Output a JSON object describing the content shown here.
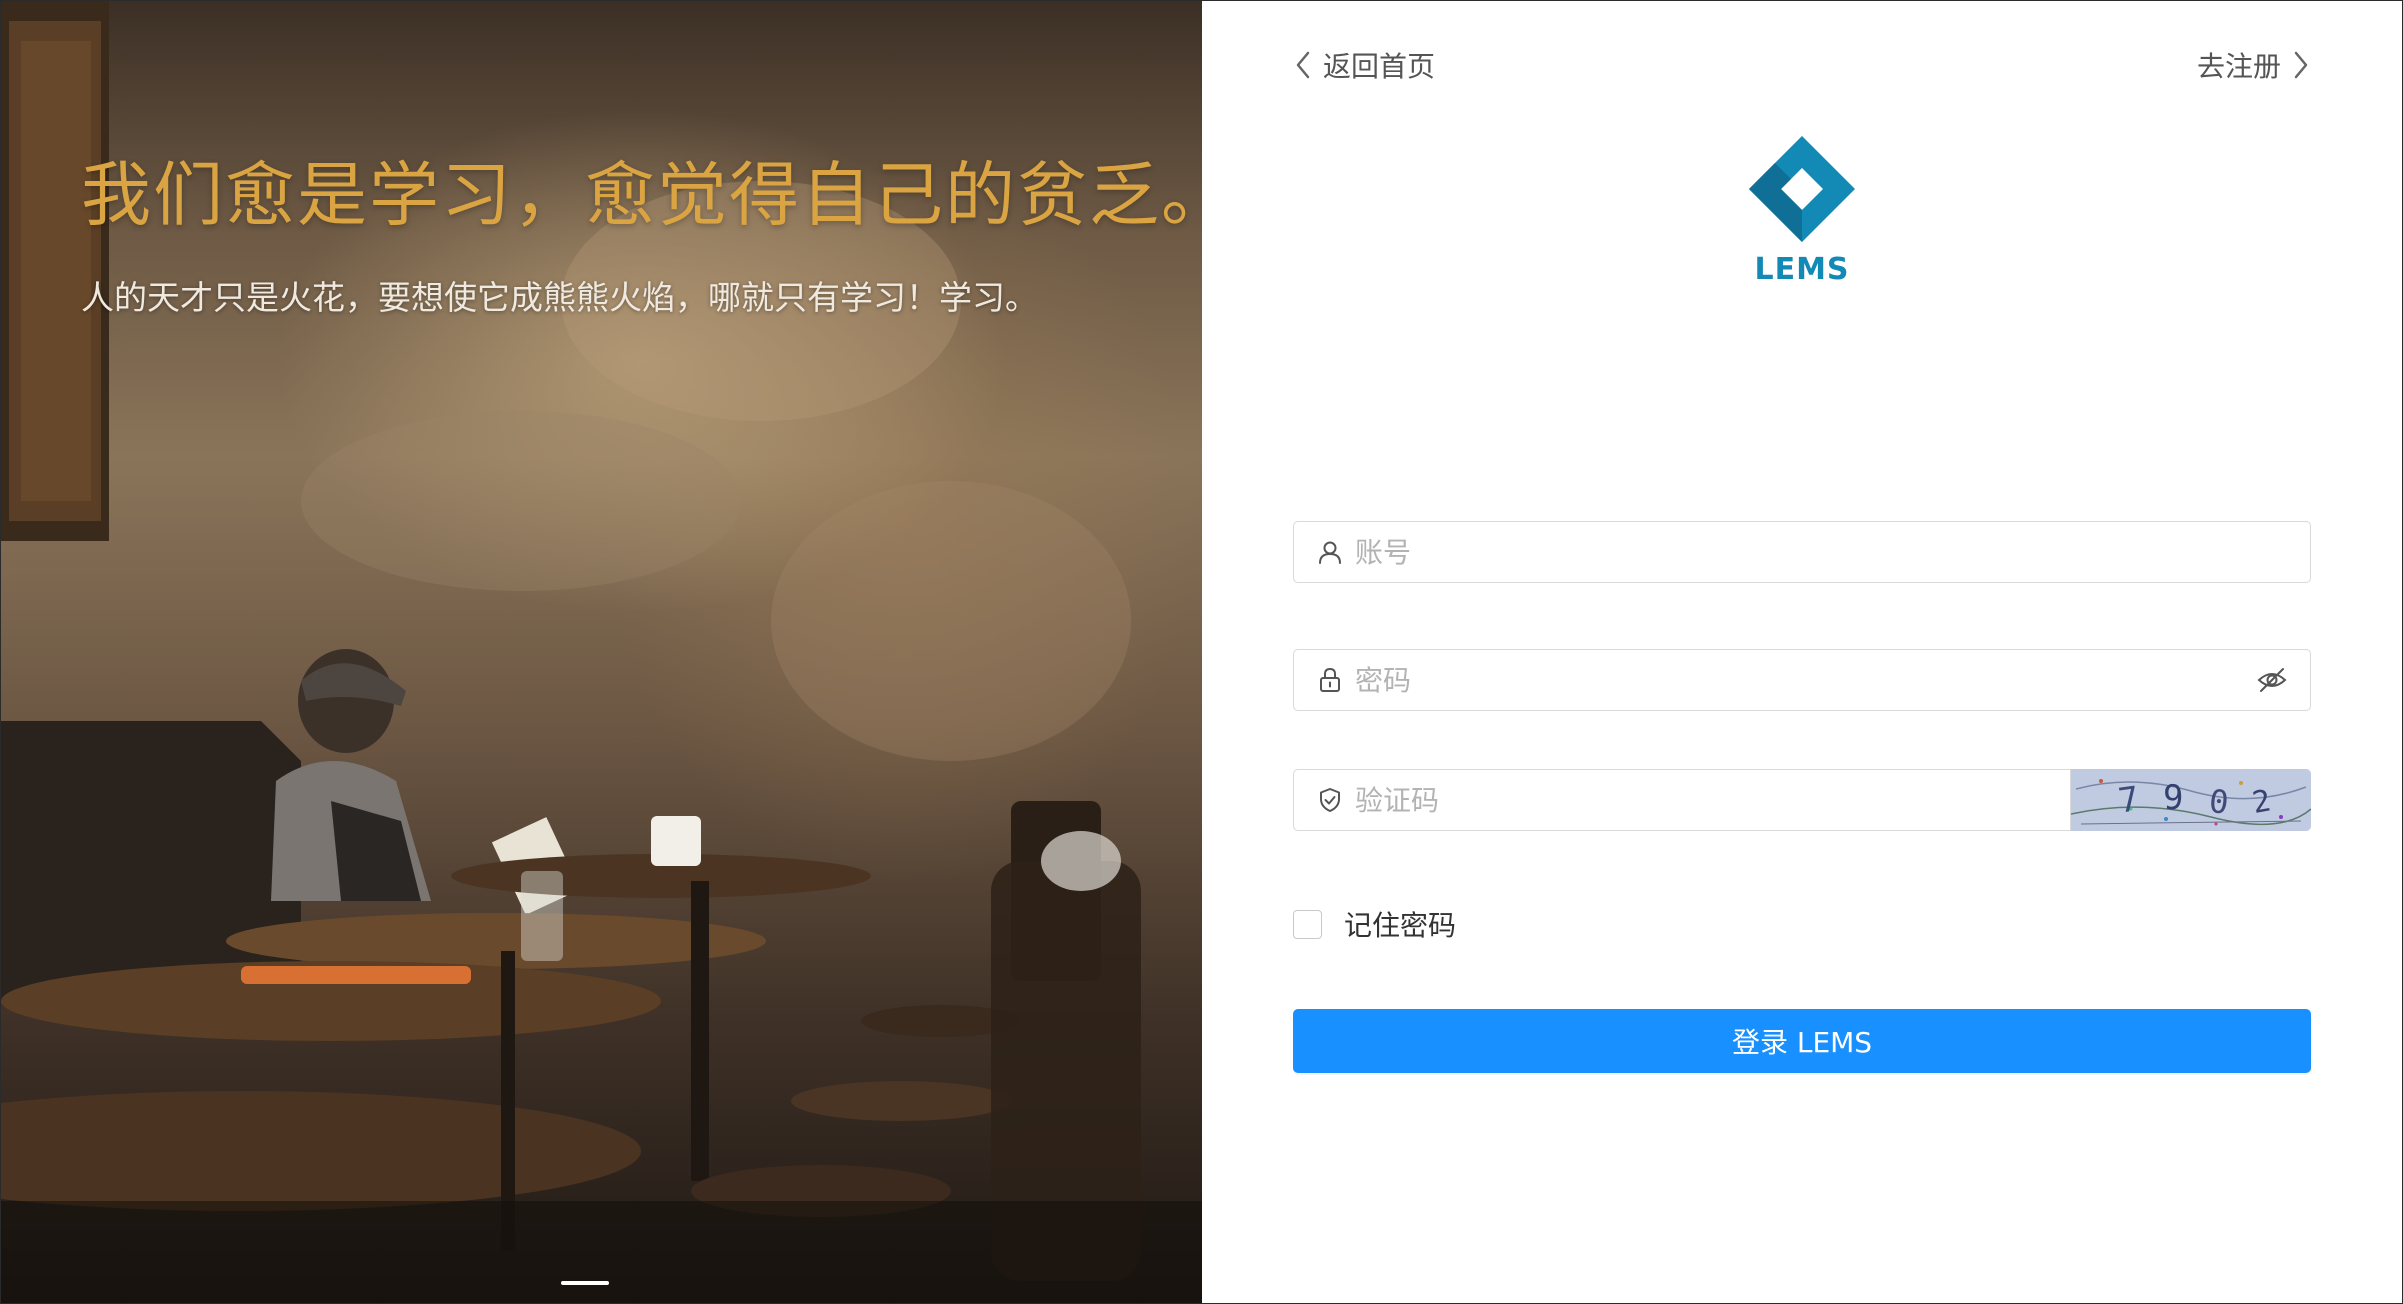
{
  "colors": {
    "headline": "#d9a441",
    "subline": "#efe9df",
    "brand": "#1389b5",
    "primary_button": "#1890ff",
    "placeholder": "#b3b3b3"
  },
  "hero": {
    "headline": "我们愈是学习，愈觉得自己的贫乏。",
    "subline": "人的天才只是火花，要想使它成熊熊火焰，哪就只有学习！学习。"
  },
  "nav": {
    "back_label": "返回首页",
    "back_icon": "chevron-left-icon",
    "register_label": "去注册",
    "register_icon": "chevron-right-icon"
  },
  "logo": {
    "text": "LEMS",
    "icon": "diamond-logo-icon"
  },
  "form": {
    "username": {
      "placeholder": "账号",
      "value": "",
      "icon": "user-icon"
    },
    "password": {
      "placeholder": "密码",
      "value": "",
      "icon": "lock-icon",
      "toggle_icon": "eye-hidden-icon"
    },
    "captcha": {
      "placeholder": "验证码",
      "value": "",
      "icon": "shield-check-icon",
      "image_text": "7902"
    },
    "remember": {
      "label": "记住密码",
      "checked": false
    },
    "submit_label": "登录 LEMS"
  },
  "carousel": {
    "slide_count": 1,
    "active_index": 0
  }
}
